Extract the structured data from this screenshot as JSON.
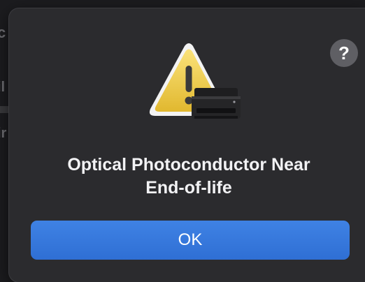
{
  "dialog": {
    "help_label": "?",
    "message_line1": "Optical Photoconductor Near",
    "message_line2": "End-of-life",
    "ok_label": "OK",
    "accent_color": "#3778dc",
    "icon": "warning-icon",
    "badge_icon": "printer-icon"
  },
  "background": {
    "fragments": [
      "c",
      "il",
      "ir"
    ]
  }
}
